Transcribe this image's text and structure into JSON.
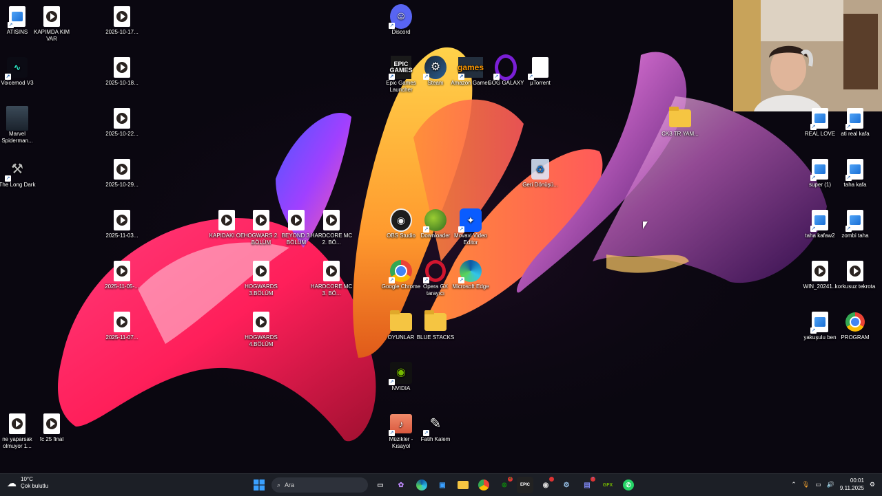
{
  "desktop": {
    "col1": [
      {
        "label": "ATISINS",
        "type": "image"
      },
      {
        "label": "Voicemod V3",
        "type": "app"
      },
      {
        "label": "Marvel Spiderman...",
        "type": "app"
      },
      {
        "label": "The Long Dark",
        "type": "app"
      },
      {
        "label": "ne yaparsak olmuyor 1...",
        "type": "video"
      }
    ],
    "col2": [
      {
        "label": "KAPIMDA KIM VAR",
        "type": "video"
      },
      {
        "label": "fc 25 final",
        "type": "video"
      }
    ],
    "col3": [
      {
        "label": "2025-10-17...",
        "type": "video"
      },
      {
        "label": "2025-10-18...",
        "type": "video"
      },
      {
        "label": "2025-10-22...",
        "type": "video"
      },
      {
        "label": "2025-10-29...",
        "type": "video"
      },
      {
        "label": "2025-11-03...",
        "type": "video"
      },
      {
        "label": "2025-11-05-...",
        "type": "video"
      },
      {
        "label": "2025-11-07...",
        "type": "video"
      }
    ],
    "middle_videos": [
      {
        "label": "KAPIDAKI OE",
        "type": "video"
      },
      {
        "label": "HOGWARS 2. BÖLÜM",
        "type": "video"
      },
      {
        "label": "BEYOND 3. BÖLÜM",
        "type": "video"
      },
      {
        "label": "HARDCORE MC 2. BÖ...",
        "type": "video"
      },
      {
        "label": "HOGWARDS 3.BÖLÜM",
        "type": "video"
      },
      {
        "label": "HARDCORE MC 3. BÖ...",
        "type": "video"
      },
      {
        "label": "HOGWARDS 4.BÖLÜM",
        "type": "video"
      }
    ],
    "apps": [
      {
        "label": "Discord"
      },
      {
        "label": "Epic Games Launcher"
      },
      {
        "label": "Steam"
      },
      {
        "label": "Amazon Games"
      },
      {
        "label": "GOG GALAXY"
      },
      {
        "label": "µTorrent"
      },
      {
        "label": "Geri Dönüşü..."
      },
      {
        "label": "CK3 TR YAM..."
      },
      {
        "label": "OBS Studio"
      },
      {
        "label": "Downloader"
      },
      {
        "label": "Movavi Video Editor"
      },
      {
        "label": "Google Chrome"
      },
      {
        "label": "Opera GX tarayıcı"
      },
      {
        "label": "Microsoft Edge"
      },
      {
        "label": "OYUNLAR"
      },
      {
        "label": "BLUE STACKS"
      },
      {
        "label": "NVIDIA"
      },
      {
        "label": "Müzikler - Kısayol"
      },
      {
        "label": "Fatih Kalem"
      }
    ],
    "right": [
      {
        "label": "REAL LOVE",
        "type": "image"
      },
      {
        "label": "ati real kafa",
        "type": "image"
      },
      {
        "label": "super (1)",
        "type": "image"
      },
      {
        "label": "taha kafa",
        "type": "image"
      },
      {
        "label": "taha kafaw2",
        "type": "image"
      },
      {
        "label": "zombi taha",
        "type": "image"
      },
      {
        "label": "WIN_20241...",
        "type": "video"
      },
      {
        "label": "korkusuz tekrota",
        "type": "video"
      },
      {
        "label": "yakuşulu ben",
        "type": "image"
      },
      {
        "label": "PROGRAM",
        "type": "chrome"
      }
    ]
  },
  "taskbar": {
    "weather_temp": "10°C",
    "weather_desc": "Çok bulutlu",
    "search_placeholder": "Ara",
    "time": "00:01",
    "date": "9.11.2025",
    "xbox_badge": "4",
    "teams_badge": "7"
  },
  "colors": {
    "taskbar_bg": "#1c1f26",
    "accent": "#0078d4"
  }
}
